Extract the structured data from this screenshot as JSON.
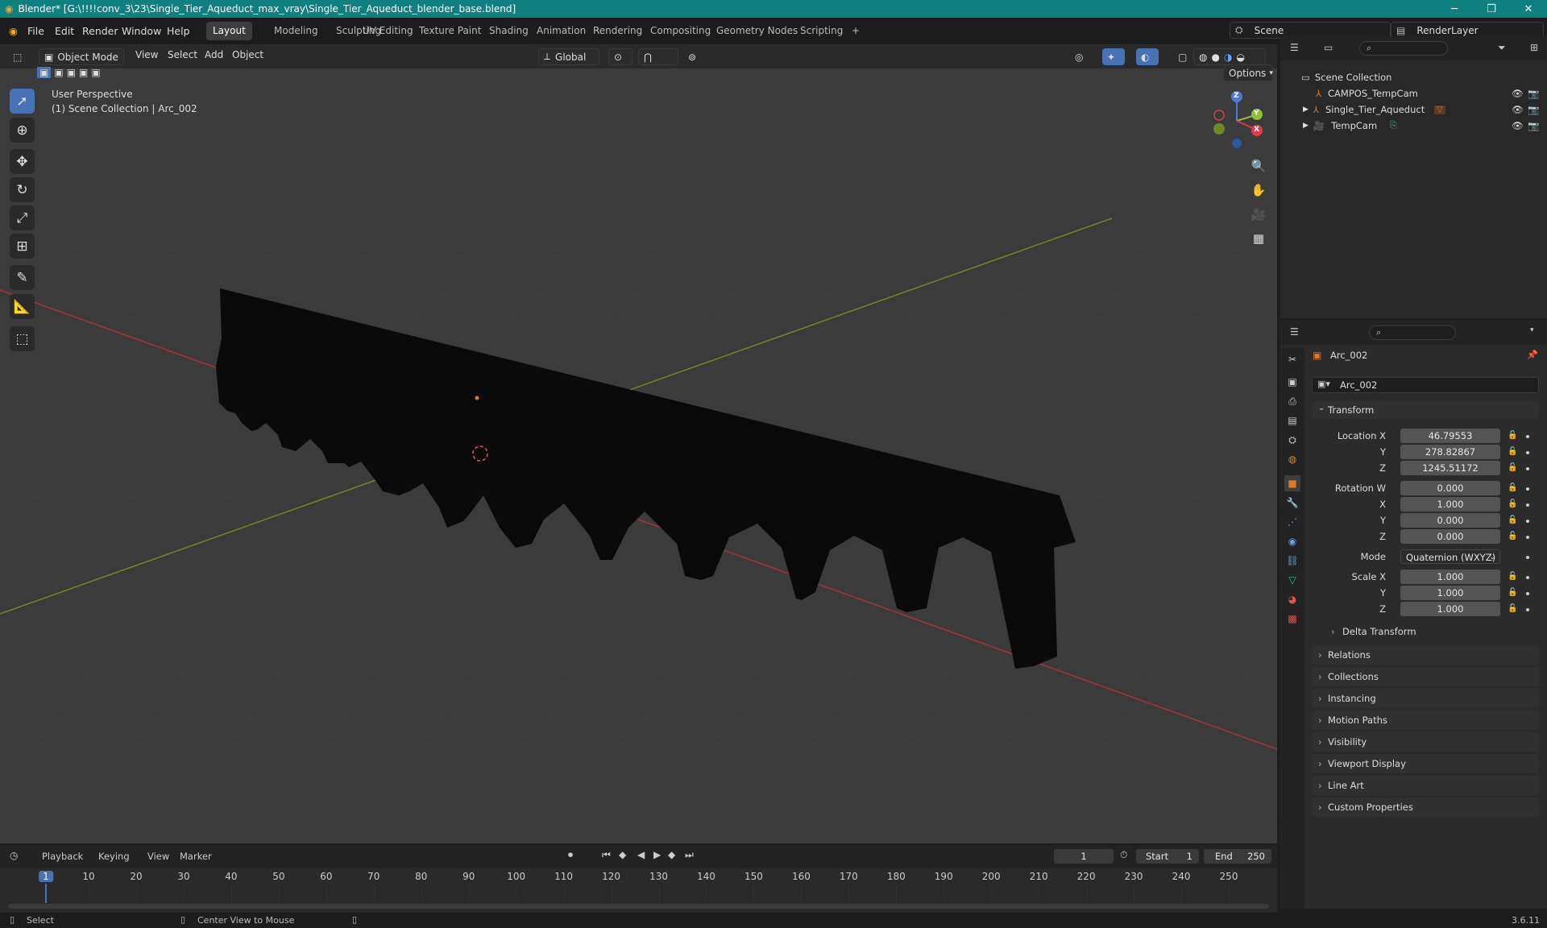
{
  "window": {
    "title": "Blender* [G:\\!!!!conv_3\\23\\Single_Tier_Aqueduct_max_vray\\Single_Tier_Aqueduct_blender_base.blend]",
    "minimize": "─",
    "maximize": "❐",
    "close": "✕"
  },
  "menu": {
    "file": "File",
    "edit": "Edit",
    "render": "Render",
    "window": "Window",
    "help": "Help"
  },
  "workspaces": [
    "Layout",
    "Modeling",
    "Sculpting",
    "UV Editing",
    "Texture Paint",
    "Shading",
    "Animation",
    "Rendering",
    "Compositing",
    "Geometry Nodes",
    "Scripting"
  ],
  "workspace_add": "+",
  "scene": {
    "label": "Scene",
    "renderlayer": "RenderLayer"
  },
  "viewport": {
    "mode": "Object Mode",
    "menus": {
      "view": "View",
      "select": "Select",
      "add": "Add",
      "object": "Object"
    },
    "orientation": "Global",
    "options": "Options",
    "perspective": "User Perspective",
    "collection_info": "(1) Scene Collection | Arc_002",
    "gizmo": {
      "x": "X",
      "y": "Y",
      "z": "Z"
    }
  },
  "outliner": {
    "root": "Scene Collection",
    "items": [
      {
        "name": "CAMPOS_TempCam"
      },
      {
        "name": "Single_Tier_Aqueduct"
      },
      {
        "name": "TempCam"
      }
    ]
  },
  "properties": {
    "object_name": "Arc_002",
    "data_name": "Arc_002",
    "transform_label": "Transform",
    "location_label": "Location X",
    "loc": {
      "x": "46.79553",
      "y": "278.82867",
      "z": "1245.51172"
    },
    "rotation_label": "Rotation W",
    "rot": {
      "w": "0.000",
      "x": "1.000",
      "y": "0.000",
      "z": "0.000"
    },
    "mode_label": "Mode",
    "mode_value": "Quaternion (WXYZ)",
    "scale_label": "Scale X",
    "scale": {
      "x": "1.000",
      "y": "1.000",
      "z": "1.000"
    },
    "axis": {
      "y": "Y",
      "z": "Z",
      "x": "X"
    },
    "delta": "Delta Transform",
    "panels": [
      "Relations",
      "Collections",
      "Instancing",
      "Motion Paths",
      "Visibility",
      "Viewport Display",
      "Line Art",
      "Custom Properties"
    ]
  },
  "timeline": {
    "menus": {
      "playback": "Playback",
      "keying": "Keying",
      "view": "View",
      "marker": "Marker"
    },
    "current_frame": "1",
    "start_label": "Start",
    "start": "1",
    "end_label": "End",
    "end": "250",
    "ticks": [
      "1",
      "10",
      "20",
      "30",
      "40",
      "50",
      "60",
      "70",
      "80",
      "90",
      "100",
      "110",
      "120",
      "130",
      "140",
      "150",
      "160",
      "170",
      "180",
      "190",
      "200",
      "210",
      "220",
      "230",
      "240",
      "250"
    ],
    "current_ratio": 0
  },
  "status": {
    "select": "Select",
    "center": "Center View to Mouse",
    "version": "3.6.11"
  },
  "colors": {
    "titlebar": "#0f8080",
    "accent": "#4772b3",
    "object": "#e07a2a"
  }
}
